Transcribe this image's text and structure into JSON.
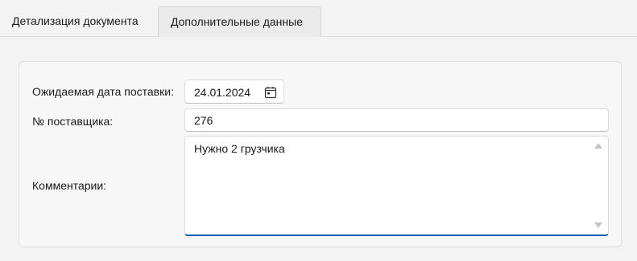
{
  "tabs": [
    {
      "label": "Детализация документа",
      "active": false
    },
    {
      "label": "Дополнительные данные",
      "active": true
    }
  ],
  "form": {
    "expected_date_label": "Ожидаемая дата поставки:",
    "expected_date_value": "24.01.2024",
    "supplier_no_label": "№ поставщика:",
    "supplier_no_value": "276",
    "comments_label": "Комментарии:",
    "comments_value": "Нужно 2 грузчика"
  },
  "icons": {
    "calendar": "calendar-icon",
    "scroll_up": "chevron-up-icon",
    "scroll_down": "chevron-down-icon"
  },
  "colors": {
    "focus_accent": "#0a5fb4",
    "background": "#f3f3f3",
    "active_tab": "#ebebeb"
  }
}
